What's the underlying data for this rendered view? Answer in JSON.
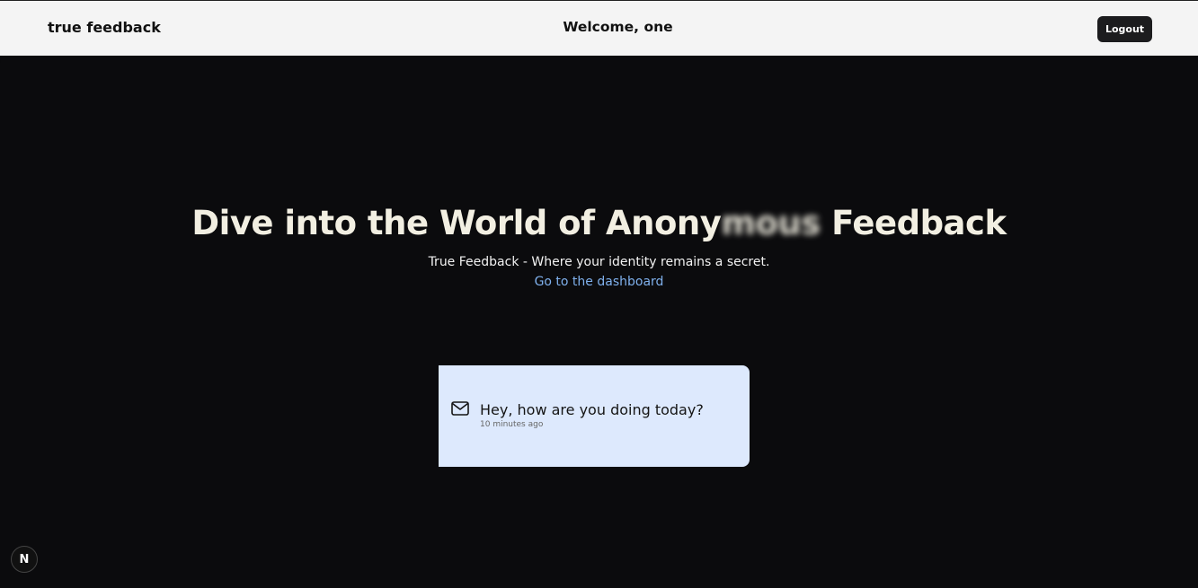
{
  "header": {
    "brand": "true feedback",
    "welcome": "Welcome, one",
    "logout_label": "Logout"
  },
  "hero": {
    "title_before": "Dive into the World of Anony",
    "title_blurred": "mous",
    "title_after": " Feedback",
    "subtitle": "True Feedback - Where your identity remains a secret.",
    "link_text": "Go to the dashboard"
  },
  "message_card": {
    "icon": "mail-icon",
    "text": "Hey, how are you doing today?",
    "time": "10 minutes ago"
  },
  "dev_badge": {
    "label": "N"
  },
  "colors": {
    "background": "#0b0b0d",
    "header_bg": "#f4f4f4",
    "card_bg": "#dde9fd",
    "link": "#7fb0ec",
    "title": "#f2efe2"
  }
}
